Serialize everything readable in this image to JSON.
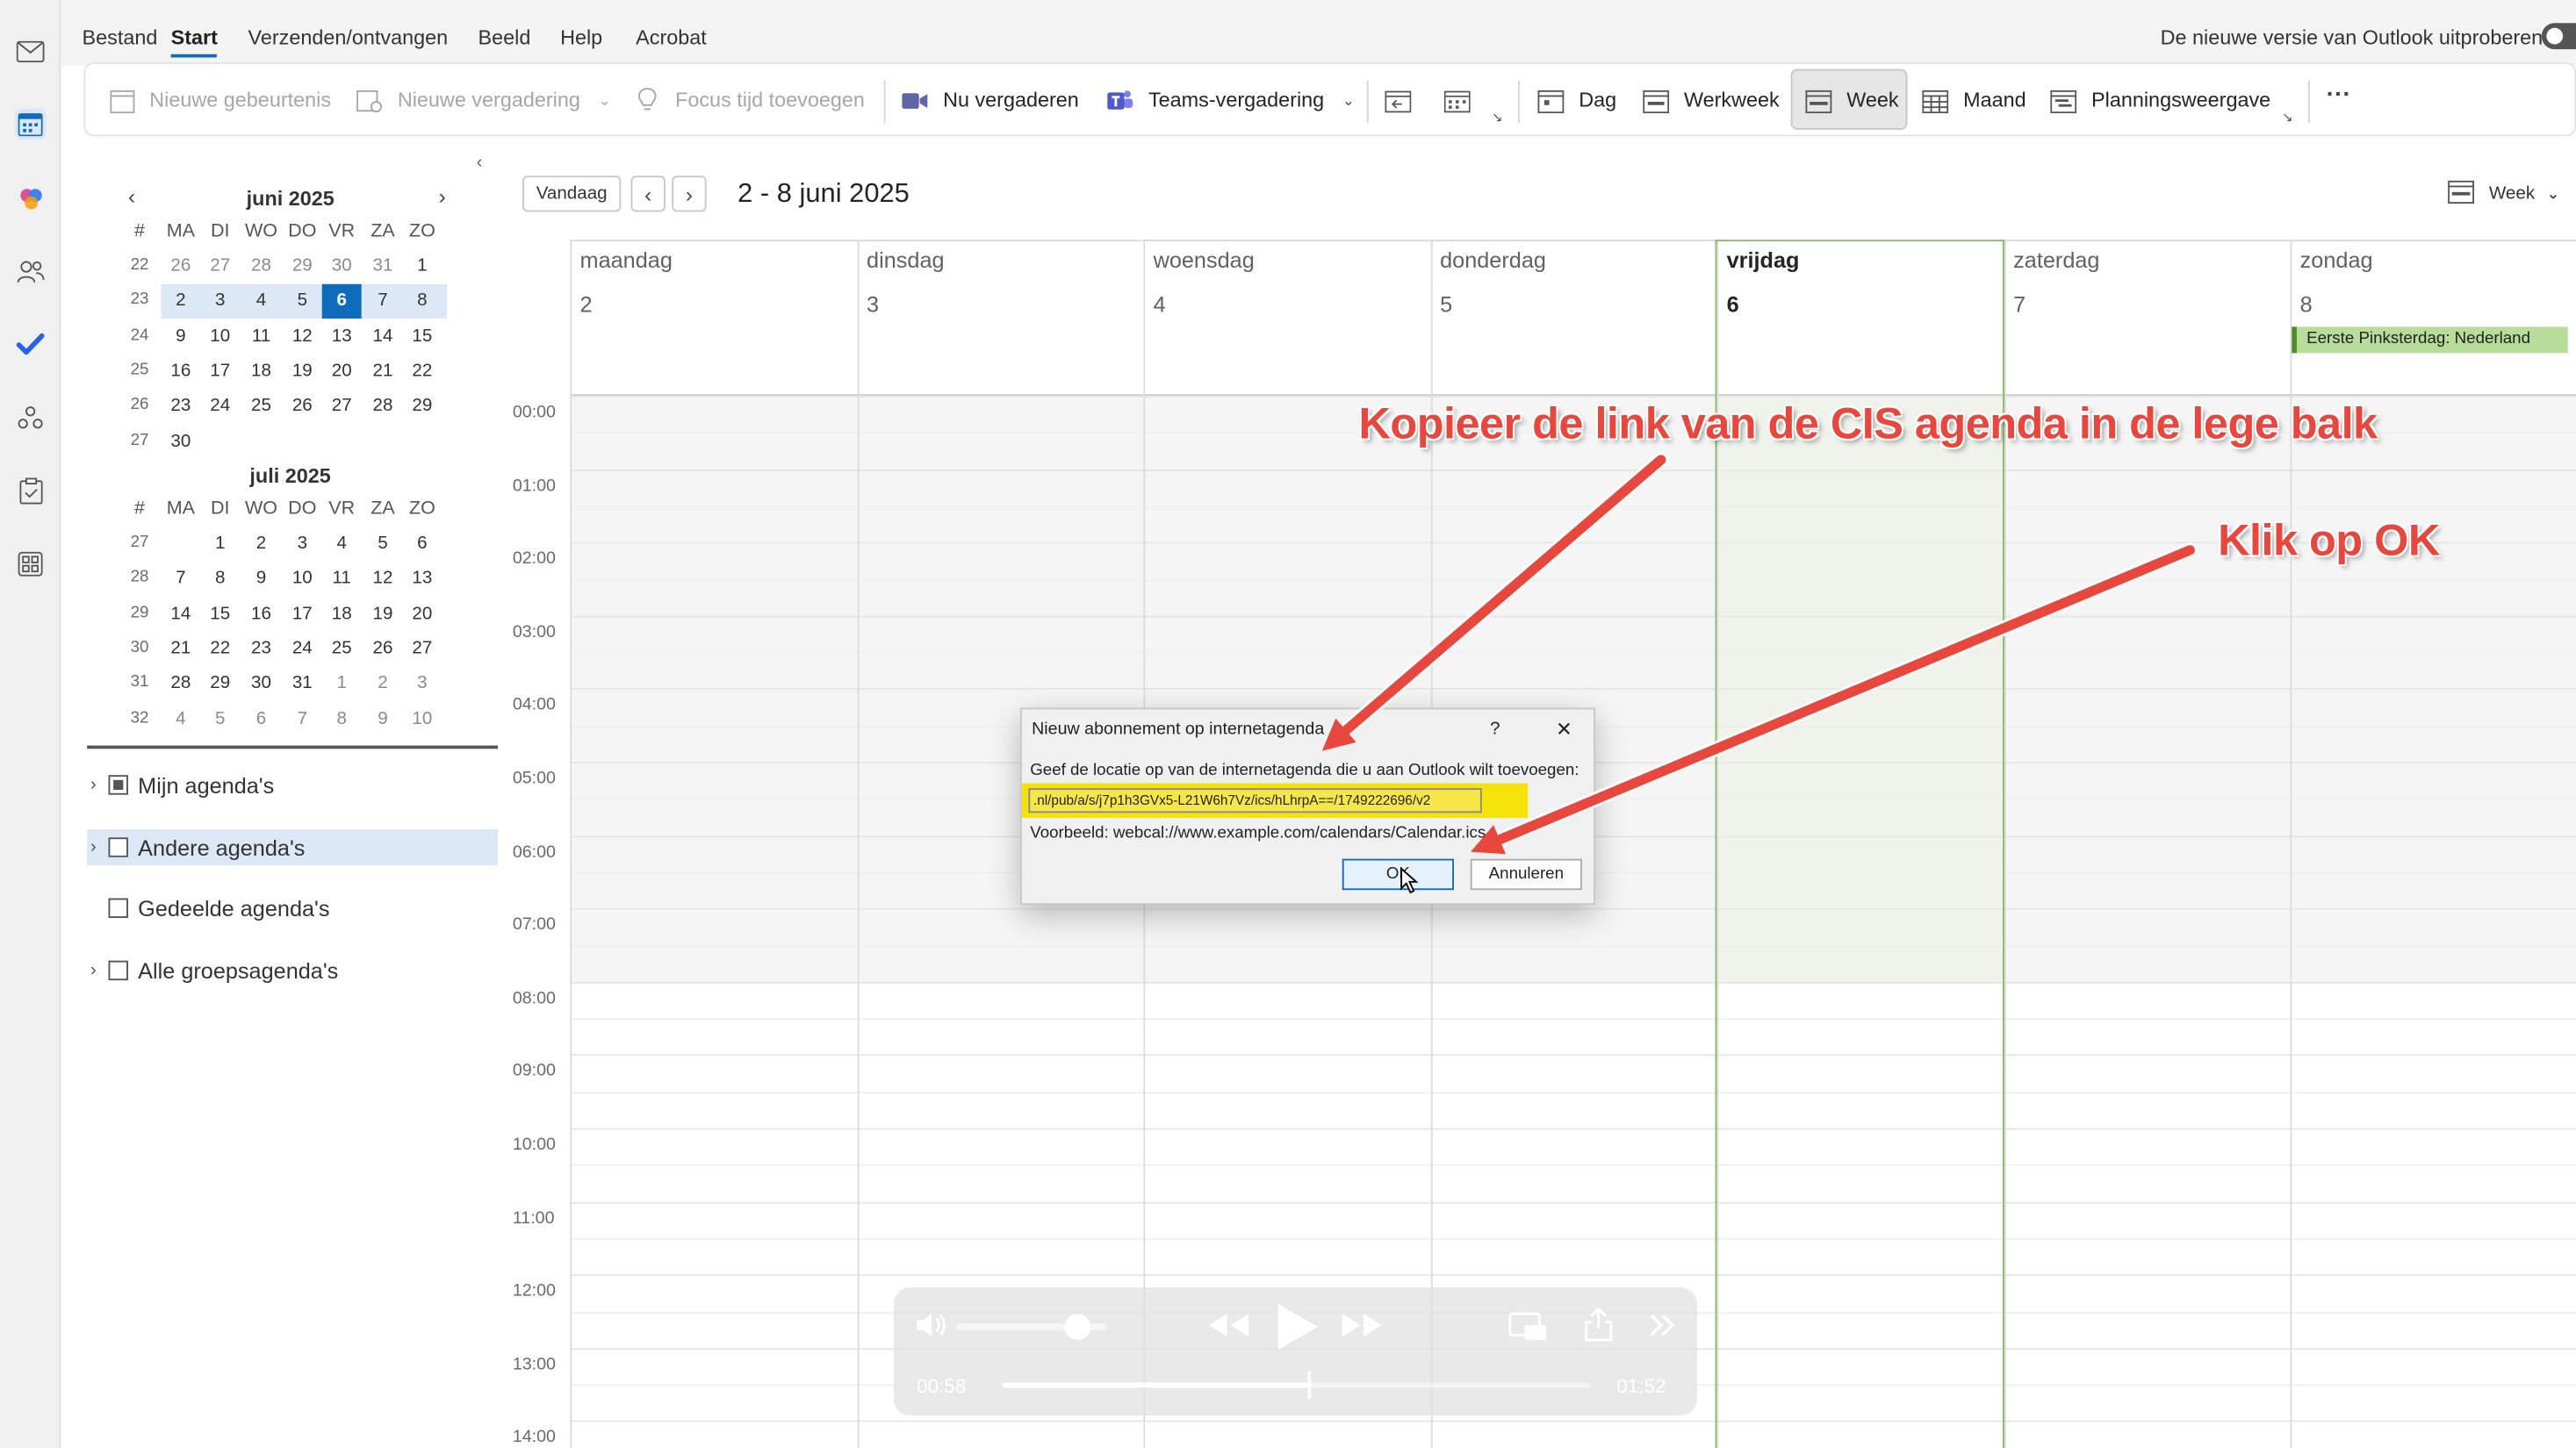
{
  "menubar": {
    "items": [
      "Bestand",
      "Start",
      "Verzenden/ontvangen",
      "Beeld",
      "Help",
      "Acrobat"
    ],
    "active": "Start",
    "new_outlook_label": "De nieuwe versie van Outlook uitproberen"
  },
  "ribbon": {
    "new_event": "Nieuwe gebeurtenis",
    "new_meeting": "Nieuwe vergadering",
    "focus_time": "Focus tijd toevoegen",
    "meet_now": "Nu vergaderen",
    "teams_meeting": "Teams-vergadering",
    "day": "Dag",
    "work_week": "Werkweek",
    "week": "Week",
    "month": "Maand",
    "schedule_view": "Planningsweergave",
    "more": "···"
  },
  "minical": {
    "june": {
      "title": "juni 2025",
      "weekday_headers": [
        "#",
        "MA",
        "DI",
        "WO",
        "DO",
        "VR",
        "ZA",
        "ZO"
      ],
      "rows": [
        [
          "22",
          "26",
          "27",
          "28",
          "29",
          "30",
          "31",
          "1"
        ],
        [
          "23",
          "2",
          "3",
          "4",
          "5",
          "6",
          "7",
          "8"
        ],
        [
          "24",
          "9",
          "10",
          "11",
          "12",
          "13",
          "14",
          "15"
        ],
        [
          "25",
          "16",
          "17",
          "18",
          "19",
          "20",
          "21",
          "22"
        ],
        [
          "26",
          "23",
          "24",
          "25",
          "26",
          "27",
          "28",
          "29"
        ],
        [
          "27",
          "30",
          "",
          "",
          "",
          "",
          "",
          ""
        ]
      ]
    },
    "july": {
      "title": "juli 2025",
      "weekday_headers": [
        "#",
        "MA",
        "DI",
        "WO",
        "DO",
        "VR",
        "ZA",
        "ZO"
      ],
      "rows": [
        [
          "27",
          "",
          "1",
          "2",
          "3",
          "4",
          "5",
          "6"
        ],
        [
          "28",
          "7",
          "8",
          "9",
          "10",
          "11",
          "12",
          "13"
        ],
        [
          "29",
          "14",
          "15",
          "16",
          "17",
          "18",
          "19",
          "20"
        ],
        [
          "30",
          "21",
          "22",
          "23",
          "24",
          "25",
          "26",
          "27"
        ],
        [
          "31",
          "28",
          "29",
          "30",
          "31",
          "1",
          "2",
          "3"
        ],
        [
          "32",
          "4",
          "5",
          "6",
          "7",
          "8",
          "9",
          "10"
        ]
      ]
    }
  },
  "calendar_groups": [
    {
      "label": "Mijn agenda's",
      "expandable": true,
      "checked": "partial"
    },
    {
      "label": "Andere agenda's",
      "expandable": true,
      "checked": "none",
      "selected": true
    },
    {
      "label": "Gedeelde agenda's",
      "expandable": false,
      "checked": "none"
    },
    {
      "label": "Alle groepsagenda's",
      "expandable": true,
      "checked": "none"
    }
  ],
  "toolbar": {
    "today": "Vandaag",
    "range_title": "2 - 8 juni 2025",
    "view_label": "Week"
  },
  "days": [
    {
      "name": "maandag",
      "num": "2"
    },
    {
      "name": "dinsdag",
      "num": "3"
    },
    {
      "name": "woensdag",
      "num": "4"
    },
    {
      "name": "donderdag",
      "num": "5"
    },
    {
      "name": "vrijdag",
      "num": "6",
      "today": true
    },
    {
      "name": "zaterdag",
      "num": "7"
    },
    {
      "name": "zondag",
      "num": "8"
    }
  ],
  "allday_event": "Eerste Pinksterdag: Nederland",
  "hours": [
    "00:00",
    "01:00",
    "02:00",
    "03:00",
    "04:00",
    "05:00",
    "06:00",
    "07:00",
    "08:00",
    "09:00",
    "10:00",
    "11:00",
    "12:00",
    "13:00",
    "14:00"
  ],
  "dialog": {
    "title": "Nieuw abonnement op internetagenda",
    "help": "?",
    "close": "✕",
    "prompt": "Geef de locatie op van de internetagenda die u aan Outlook wilt toevoegen:",
    "url_value": ".nl/pub/a/s/j7p1h3GVx5-L21W6h7Vz/ics/hLhrpA==/1749222696/v2",
    "example": "Voorbeeld: webcal://www.example.com/calendars/Calendar.ics",
    "ok": "OK",
    "cancel": "Annuleren"
  },
  "annotations": {
    "copy_link": "Kopieer de link van de CIS agenda in de lege balk",
    "click_ok": "Klik op OK"
  },
  "player": {
    "elapsed": "00:58",
    "total": "01:52",
    "progress": 0.52,
    "volume": 0.8
  },
  "colors": {
    "accent": "#0f6cbd",
    "today_border": "#8dbb6a",
    "annotation": "#e8473e",
    "highlight": "#f5e20b",
    "event_green": "#b8dc9a"
  }
}
